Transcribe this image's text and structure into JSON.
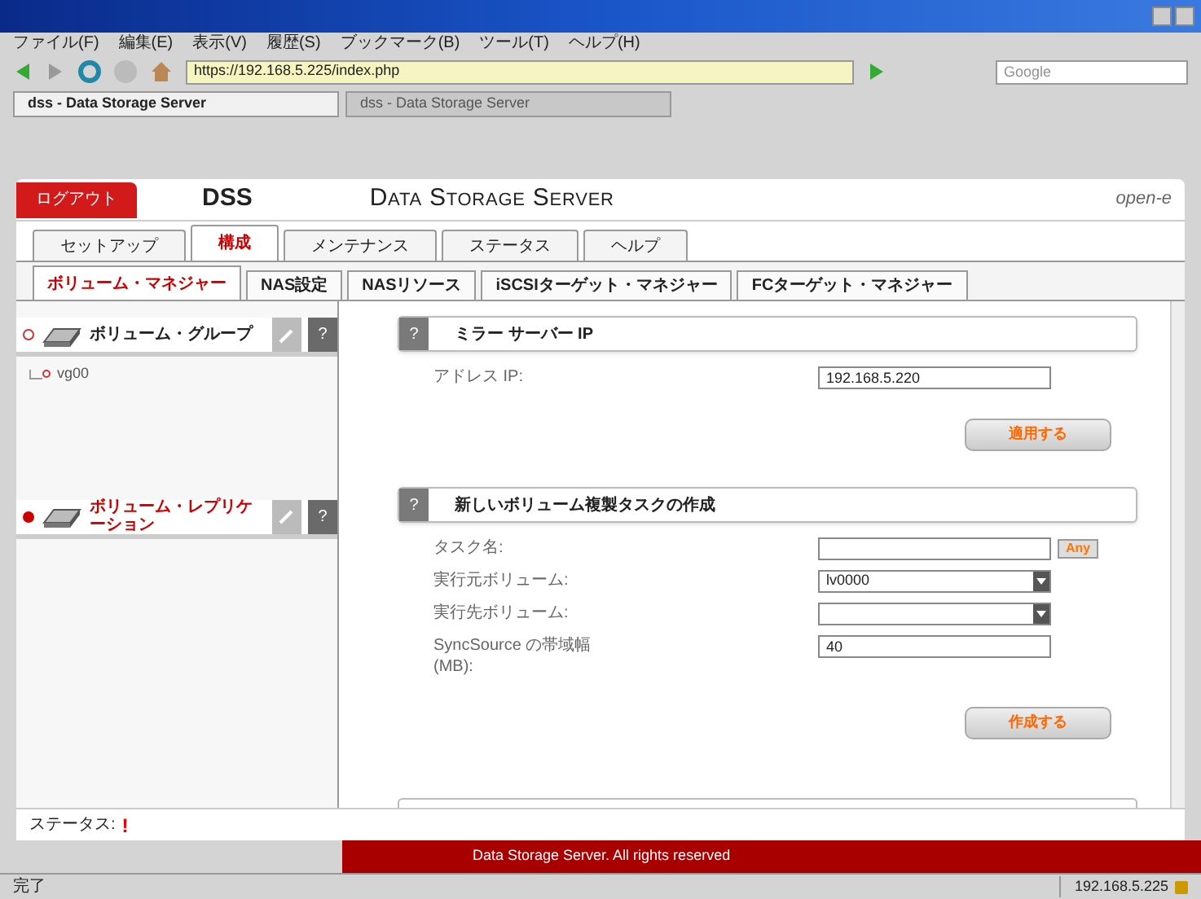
{
  "menu_bar": [
    "ファイル(F)",
    "編集(E)",
    "表示(V)",
    "履歴(S)",
    "ブックマーク(B)",
    "ツール(T)",
    "ヘルプ(H)"
  ],
  "address_bar": {
    "value": "https://192.168.5.225/index.php"
  },
  "search_field": {
    "placeholder": "Google"
  },
  "browser_tabs": [
    {
      "label": "dss - Data Storage Server",
      "selected": true
    },
    {
      "label": "dss - Data Storage Server",
      "selected": false
    }
  ],
  "header": {
    "logout": "ログアウト",
    "product": "DSS",
    "title": "Data Storage Server",
    "logo": "open-e"
  },
  "main_tabs": [
    {
      "label": "セットアップ",
      "selected": false
    },
    {
      "label": "構成",
      "selected": true
    },
    {
      "label": "メンテナンス",
      "selected": false
    },
    {
      "label": "ステータス",
      "selected": false
    },
    {
      "label": "ヘルプ",
      "selected": false
    }
  ],
  "sub_tabs": [
    {
      "label": "ボリューム・マネジャー",
      "selected": true
    },
    {
      "label": "NAS設定",
      "selected": false
    },
    {
      "label": "NASリソース",
      "selected": false
    },
    {
      "label": "iSCSIターゲット・マネジャー",
      "selected": false
    },
    {
      "label": "FCターゲット・マネジャー",
      "selected": false
    }
  ],
  "sidebar": [
    {
      "title": "ボリューム・グループ",
      "help": "?",
      "selected": false,
      "children": [
        {
          "label": "vg00"
        }
      ]
    },
    {
      "title": "ボリューム・レプリケーション",
      "help": "?",
      "selected": true
    }
  ],
  "sections": [
    {
      "title": "ミラー サーバー IP",
      "help": "?",
      "fields": [
        {
          "kind": "text",
          "label": "アドレス IP:",
          "value": "192.168.5.220"
        }
      ],
      "button": "適用する"
    },
    {
      "title": "新しいボリューム複製タスクの作成",
      "help": "?",
      "fields": [
        {
          "kind": "text",
          "label": "タスク名:",
          "extra": "Any"
        },
        {
          "kind": "select",
          "label": "実行元ボリューム:",
          "value": "lv0000"
        },
        {
          "kind": "select",
          "label": "実行先ボリューム:"
        },
        {
          "kind": "text",
          "label": "SyncSource の帯域幅 (MB):",
          "value": "40"
        }
      ],
      "button": "作成する"
    }
  ],
  "status": {
    "label": "ステータス:",
    "mark": "!"
  },
  "footer": "Data Storage Server. All rights reserved",
  "status_bar": {
    "text": "完了",
    "host": "192.168.5.225"
  }
}
